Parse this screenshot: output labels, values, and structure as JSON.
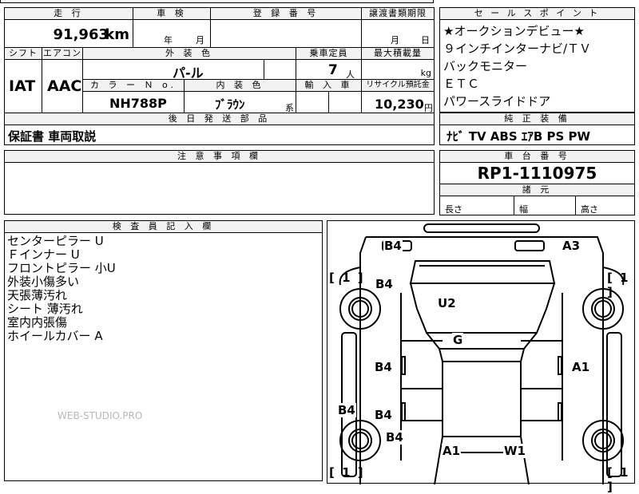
{
  "header": {
    "mileage_label": "走 行",
    "mileage_value": "91,963",
    "mileage_unit": "km",
    "inspection_label": "車 検",
    "year_unit": "年",
    "month_unit": "月",
    "registration_label": "登 録 番 号",
    "transfer_label": "譲渡書類期限",
    "day_unit": "日"
  },
  "row2": {
    "shift_label": "シフト",
    "shift_value": "IAT",
    "aircon_label": "エアコン",
    "aircon_value": "AAC",
    "exterior_label": "外 装 色",
    "exterior_value": "パ-ル",
    "capacity_label": "乗車定員",
    "capacity_value": "7",
    "capacity_unit": "人",
    "maxload_label": "最大積載量",
    "maxload_unit": "kg",
    "colorno_label": "カ ラ ー Ｎ o.",
    "colorno_value": "NH788P",
    "interior_label": "内 装 色",
    "interior_value": "ﾌﾞﾗｳﾝ",
    "interior_suffix": "系",
    "import_label": "輸 入 車",
    "recycle_label": "リサイクル預託金",
    "recycle_value": "10,230",
    "recycle_unit": "円"
  },
  "later_parts": {
    "label": "後 日 発 送 部 品",
    "value": "保証書 車両取説"
  },
  "caution": {
    "label": "注 意 事 項 欄"
  },
  "sales_points": {
    "label": "セ ー ル ス ポ イ ン ト",
    "items": [
      "★オークションデビュー★",
      "９インチインターナビ/ＴＶ",
      "バックモニター",
      "ＥＴＣ",
      "パワースライドドア"
    ]
  },
  "equipment": {
    "label": "純 正 装 備",
    "value": "ﾅﾋﾞ TV ABS ｴｱB PS PW"
  },
  "chassis": {
    "label": "車 台 番 号",
    "value": "RP1-1110975"
  },
  "dimensions": {
    "label": "諸 元",
    "length": "長さ",
    "width": "幅",
    "height": "高さ"
  },
  "inspector": {
    "label": "検 査 員 記 入 欄",
    "notes": [
      "センターピラー U",
      "Ｆインナー U",
      "フロントピラー 小U",
      "外装小傷多い",
      "天張薄汚れ",
      "シート 薄汚れ",
      "室内内張傷",
      "ホイールカバー A"
    ],
    "watermark": "WEB-STUDIO.PRO"
  },
  "diagram": {
    "tire_marks": {
      "front_left": "[ 1 ]",
      "front_right": "[ 1 ]",
      "rear_left": "[ 1 ]",
      "rear_right": "[ 1 ]"
    },
    "damage": {
      "front_bumper_left": "B4",
      "front_bumper_right": "A3",
      "hood_left": "B4",
      "hood": "U2",
      "roof": "G",
      "front_door_left": "B4",
      "front_door_right": "A1",
      "rear_door_left": "B4",
      "sill_left": "B4",
      "rear_quarter_left": "B4",
      "rear_left": "A1",
      "rear_right": "W1"
    }
  }
}
